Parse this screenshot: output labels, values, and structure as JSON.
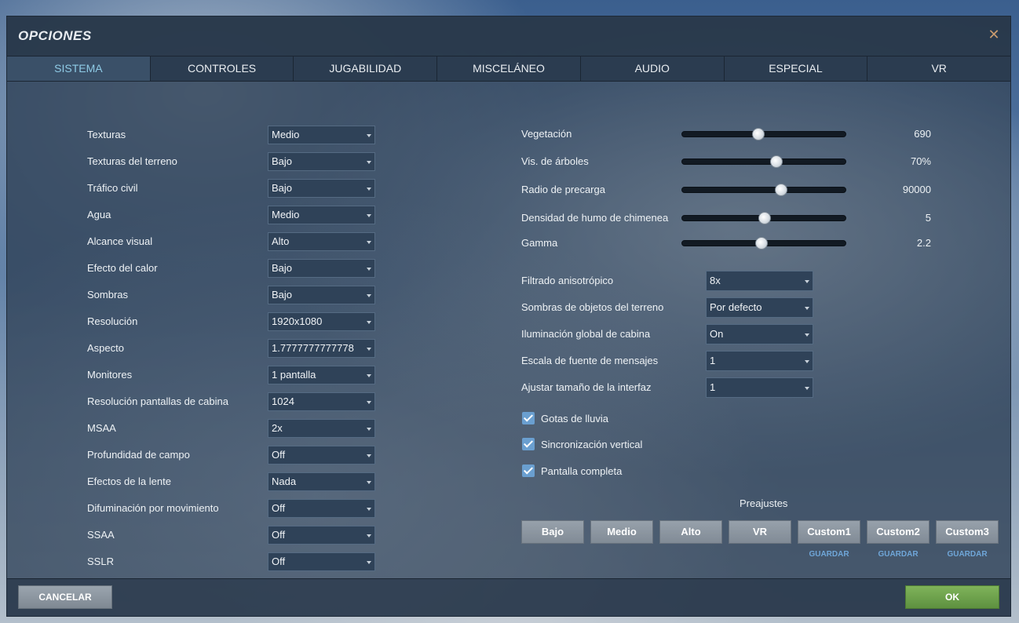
{
  "window": {
    "title": "OPCIONES",
    "close_icon": "close-icon"
  },
  "tabs": [
    {
      "label": "SISTEMA",
      "active": true
    },
    {
      "label": "CONTROLES",
      "active": false
    },
    {
      "label": "JUGABILIDAD",
      "active": false
    },
    {
      "label": "MISCELÁNEO",
      "active": false
    },
    {
      "label": "AUDIO",
      "active": false
    },
    {
      "label": "ESPECIAL",
      "active": false
    },
    {
      "label": "VR",
      "active": false
    }
  ],
  "left_settings": [
    {
      "label": "Texturas",
      "value": "Medio"
    },
    {
      "label": "Texturas del terreno",
      "value": "Bajo"
    },
    {
      "label": "Tráfico civil",
      "value": "Bajo"
    },
    {
      "label": "Agua",
      "value": "Medio"
    },
    {
      "label": "Alcance visual",
      "value": "Alto"
    },
    {
      "label": "Efecto del calor",
      "value": "Bajo"
    },
    {
      "label": "Sombras",
      "value": "Bajo"
    },
    {
      "label": "Resolución",
      "value": "1920x1080"
    },
    {
      "label": "Aspecto",
      "value": "1.7777777777778"
    },
    {
      "label": "Monitores",
      "value": "1 pantalla"
    },
    {
      "label": "Resolución pantallas de cabina",
      "value": "1024"
    },
    {
      "label": "MSAA",
      "value": "2x"
    },
    {
      "label": "Profundidad de campo",
      "value": "Off"
    },
    {
      "label": "Efectos de la lente",
      "value": "Nada"
    },
    {
      "label": "Difuminación por movimiento",
      "value": "Off"
    },
    {
      "label": "SSAA",
      "value": "Off"
    },
    {
      "label": "SSLR",
      "value": "Off"
    }
  ],
  "sliders": [
    {
      "label": "Vegetación",
      "value": "690",
      "fraction": 0.46
    },
    {
      "label": "Vis. de árboles",
      "value": "70%",
      "fraction": 0.57
    },
    {
      "label": "Radio de precarga",
      "value": "90000",
      "fraction": 0.6
    },
    {
      "label": "Densidad de humo de chimenea",
      "value": "5",
      "fraction": 0.5
    },
    {
      "label": "Gamma",
      "value": "2.2",
      "fraction": 0.48
    }
  ],
  "right_settings": [
    {
      "label": "Filtrado anisotrópico",
      "value": "8x"
    },
    {
      "label": "Sombras de objetos del terreno",
      "value": "Por defecto"
    },
    {
      "label": "Iluminación global de cabina",
      "value": "On"
    },
    {
      "label": "Escala de fuente de mensajes",
      "value": "1"
    },
    {
      "label": "Ajustar tamaño de la interfaz",
      "value": "1"
    }
  ],
  "checkboxes": [
    {
      "label": "Gotas de lluvia",
      "checked": true
    },
    {
      "label": "Sincronización vertical",
      "checked": true
    },
    {
      "label": "Pantalla completa",
      "checked": true
    }
  ],
  "presets": {
    "title": "Preajustes",
    "buttons": [
      "Bajo",
      "Medio",
      "Alto",
      "VR",
      "Custom1",
      "Custom2",
      "Custom3"
    ],
    "save_label": "GUARDAR"
  },
  "footer": {
    "cancel_label": "CANCELAR",
    "ok_label": "OK"
  }
}
